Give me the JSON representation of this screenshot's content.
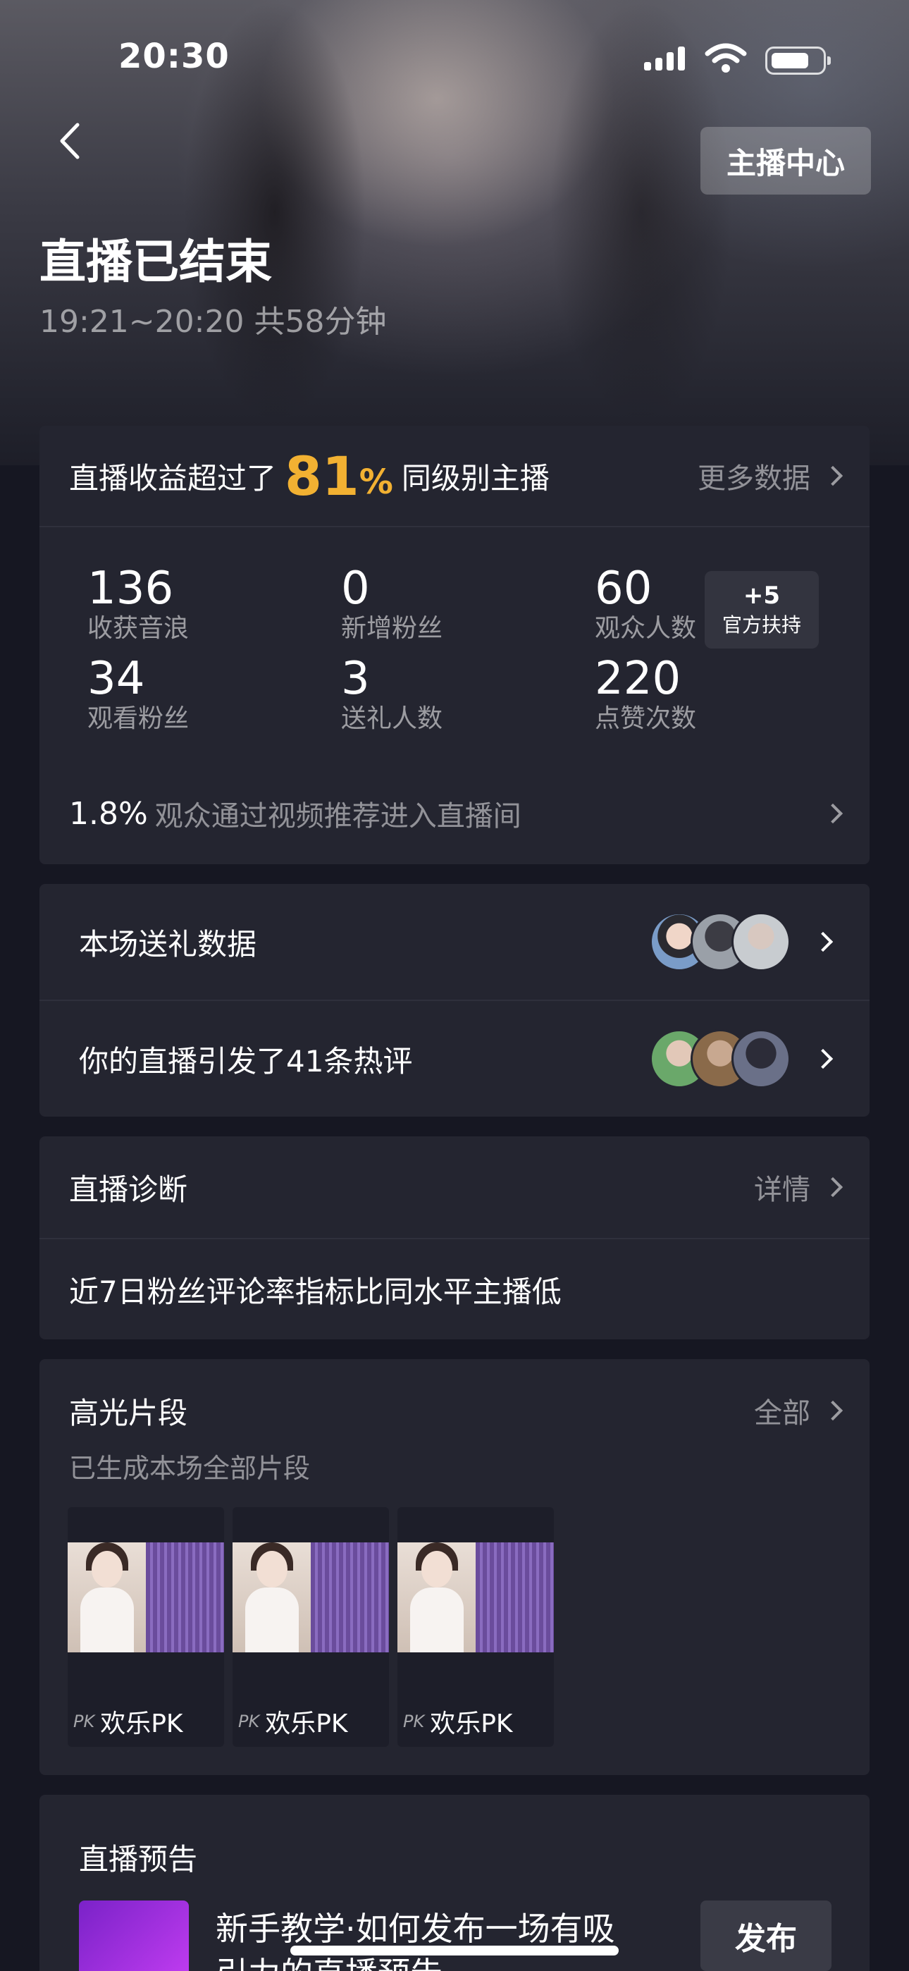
{
  "status_bar": {
    "time": "20:30"
  },
  "header": {
    "anchor_center_label": "主播中心",
    "title": "直播已结束",
    "subtitle": "19:21~20:20 共58分钟"
  },
  "summary_card": {
    "lead_text": "直播收益超过了",
    "percent": "81",
    "percent_sign": "%",
    "tail_text": "同级别主播",
    "more_label": "更多数据",
    "stats": [
      {
        "value": "136",
        "label": "收获音浪"
      },
      {
        "value": "0",
        "label": "新增粉丝"
      },
      {
        "value": "60",
        "label": "观众人数"
      },
      {
        "value": "34",
        "label": "观看粉丝"
      },
      {
        "value": "3",
        "label": "送礼人数"
      },
      {
        "value": "220",
        "label": "点赞次数"
      }
    ],
    "support_badge": {
      "value": "+5",
      "label": "官方扶持"
    },
    "footer_value": "1.8%",
    "footer_text": "观众通过视频推荐进入直播间"
  },
  "gift_card": {
    "gift_label": "本场送礼数据",
    "comments_label": "你的直播引发了41条热评"
  },
  "diagnosis_card": {
    "title": "直播诊断",
    "detail_label": "详情",
    "message": "近7日粉丝评论率指标比同水平主播低"
  },
  "highlights_card": {
    "title": "高光片段",
    "all_label": "全部",
    "subtitle": "已生成本场全部片段",
    "clips": [
      {
        "caption": "欢乐PK",
        "pk_mark": "PK"
      },
      {
        "caption": "欢乐PK",
        "pk_mark": "PK"
      },
      {
        "caption": "欢乐PK",
        "pk_mark": "PK"
      }
    ]
  },
  "preview_card": {
    "title": "直播预告",
    "line1": "新手教学·如何发布一场有吸",
    "line2": "引力的直播预告",
    "publish_label": "发布"
  },
  "colors": {
    "accent": "#f2b132",
    "card": "#242530",
    "background": "#161722"
  }
}
